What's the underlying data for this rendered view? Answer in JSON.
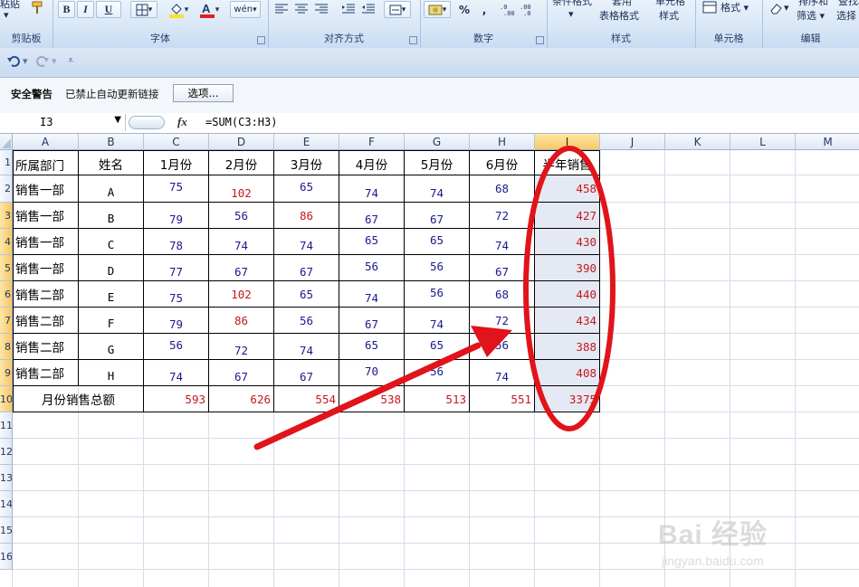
{
  "ribbon": {
    "groups": [
      {
        "label": "剪贴板",
        "top_text": "粘贴"
      },
      {
        "label": "字体"
      },
      {
        "label": "对齐方式"
      },
      {
        "label": "数字",
        "percent": "%",
        "comma": ","
      },
      {
        "label": "样式",
        "table_format": "表格格式",
        "cell_style": "样式",
        "cond_format": "条件格式",
        "apply": "套用",
        "cell_style_top": "单元格"
      },
      {
        "label": "单元格",
        "format": "格式"
      },
      {
        "label": "编辑",
        "sort_filter": "筛选",
        "find_select": "选择",
        "sort_top": "排序和",
        "find_top": "查找和"
      }
    ],
    "font_buttons": {
      "bold": "B",
      "italic": "I",
      "underline": "U",
      "wen": "wén"
    },
    "font_color": "#e01e1e",
    "fill_color": "#f2e430"
  },
  "security_bar": {
    "title": "安全警告",
    "message": "已禁止自动更新链接",
    "options_button": "选项..."
  },
  "formula_bar": {
    "name_box": "I3",
    "fx": "fx",
    "formula": "=SUM(C3:H3)"
  },
  "columns": [
    "A",
    "B",
    "C",
    "D",
    "E",
    "F",
    "G",
    "H",
    "I",
    "J",
    "K",
    "L",
    "M"
  ],
  "rows": [
    "1",
    "2",
    "3",
    "4",
    "5",
    "6",
    "7",
    "8",
    "9",
    "10",
    "11",
    "12",
    "13",
    "14",
    "15",
    "16"
  ],
  "table": {
    "headers": [
      "所属部门",
      "姓名",
      "1月份",
      "2月份",
      "3月份",
      "4月份",
      "5月份",
      "6月份",
      "半年销售"
    ],
    "body": [
      {
        "dept": "销售一部",
        "name": "A",
        "m": [
          "75",
          "102",
          "65",
          "74",
          "74",
          "68"
        ],
        "total": "458"
      },
      {
        "dept": "销售一部",
        "name": "B",
        "m": [
          "79",
          "56",
          "86",
          "67",
          "67",
          "72"
        ],
        "total": "427"
      },
      {
        "dept": "销售一部",
        "name": "C",
        "m": [
          "78",
          "74",
          "74",
          "65",
          "65",
          "74"
        ],
        "total": "430"
      },
      {
        "dept": "销售一部",
        "name": "D",
        "m": [
          "77",
          "67",
          "67",
          "56",
          "56",
          "67"
        ],
        "total": "390"
      },
      {
        "dept": "销售二部",
        "name": "E",
        "m": [
          "75",
          "102",
          "65",
          "74",
          "56",
          "68"
        ],
        "total": "440"
      },
      {
        "dept": "销售二部",
        "name": "F",
        "m": [
          "79",
          "86",
          "56",
          "67",
          "74",
          "72"
        ],
        "total": "434"
      },
      {
        "dept": "销售二部",
        "name": "G",
        "m": [
          "56",
          "72",
          "74",
          "65",
          "65",
          "56"
        ],
        "total": "388"
      },
      {
        "dept": "销售二部",
        "name": "H",
        "m": [
          "74",
          "67",
          "67",
          "70",
          "56",
          "74"
        ],
        "total": "408"
      }
    ],
    "footer": {
      "label": "月份销售总额",
      "totals": [
        "593",
        "626",
        "554",
        "538",
        "513",
        "551"
      ],
      "grand": "3375"
    }
  },
  "annotation_color": "#e0141a",
  "watermark": {
    "brand": "Bai 经验",
    "url": "jingyan.baidu.com"
  }
}
